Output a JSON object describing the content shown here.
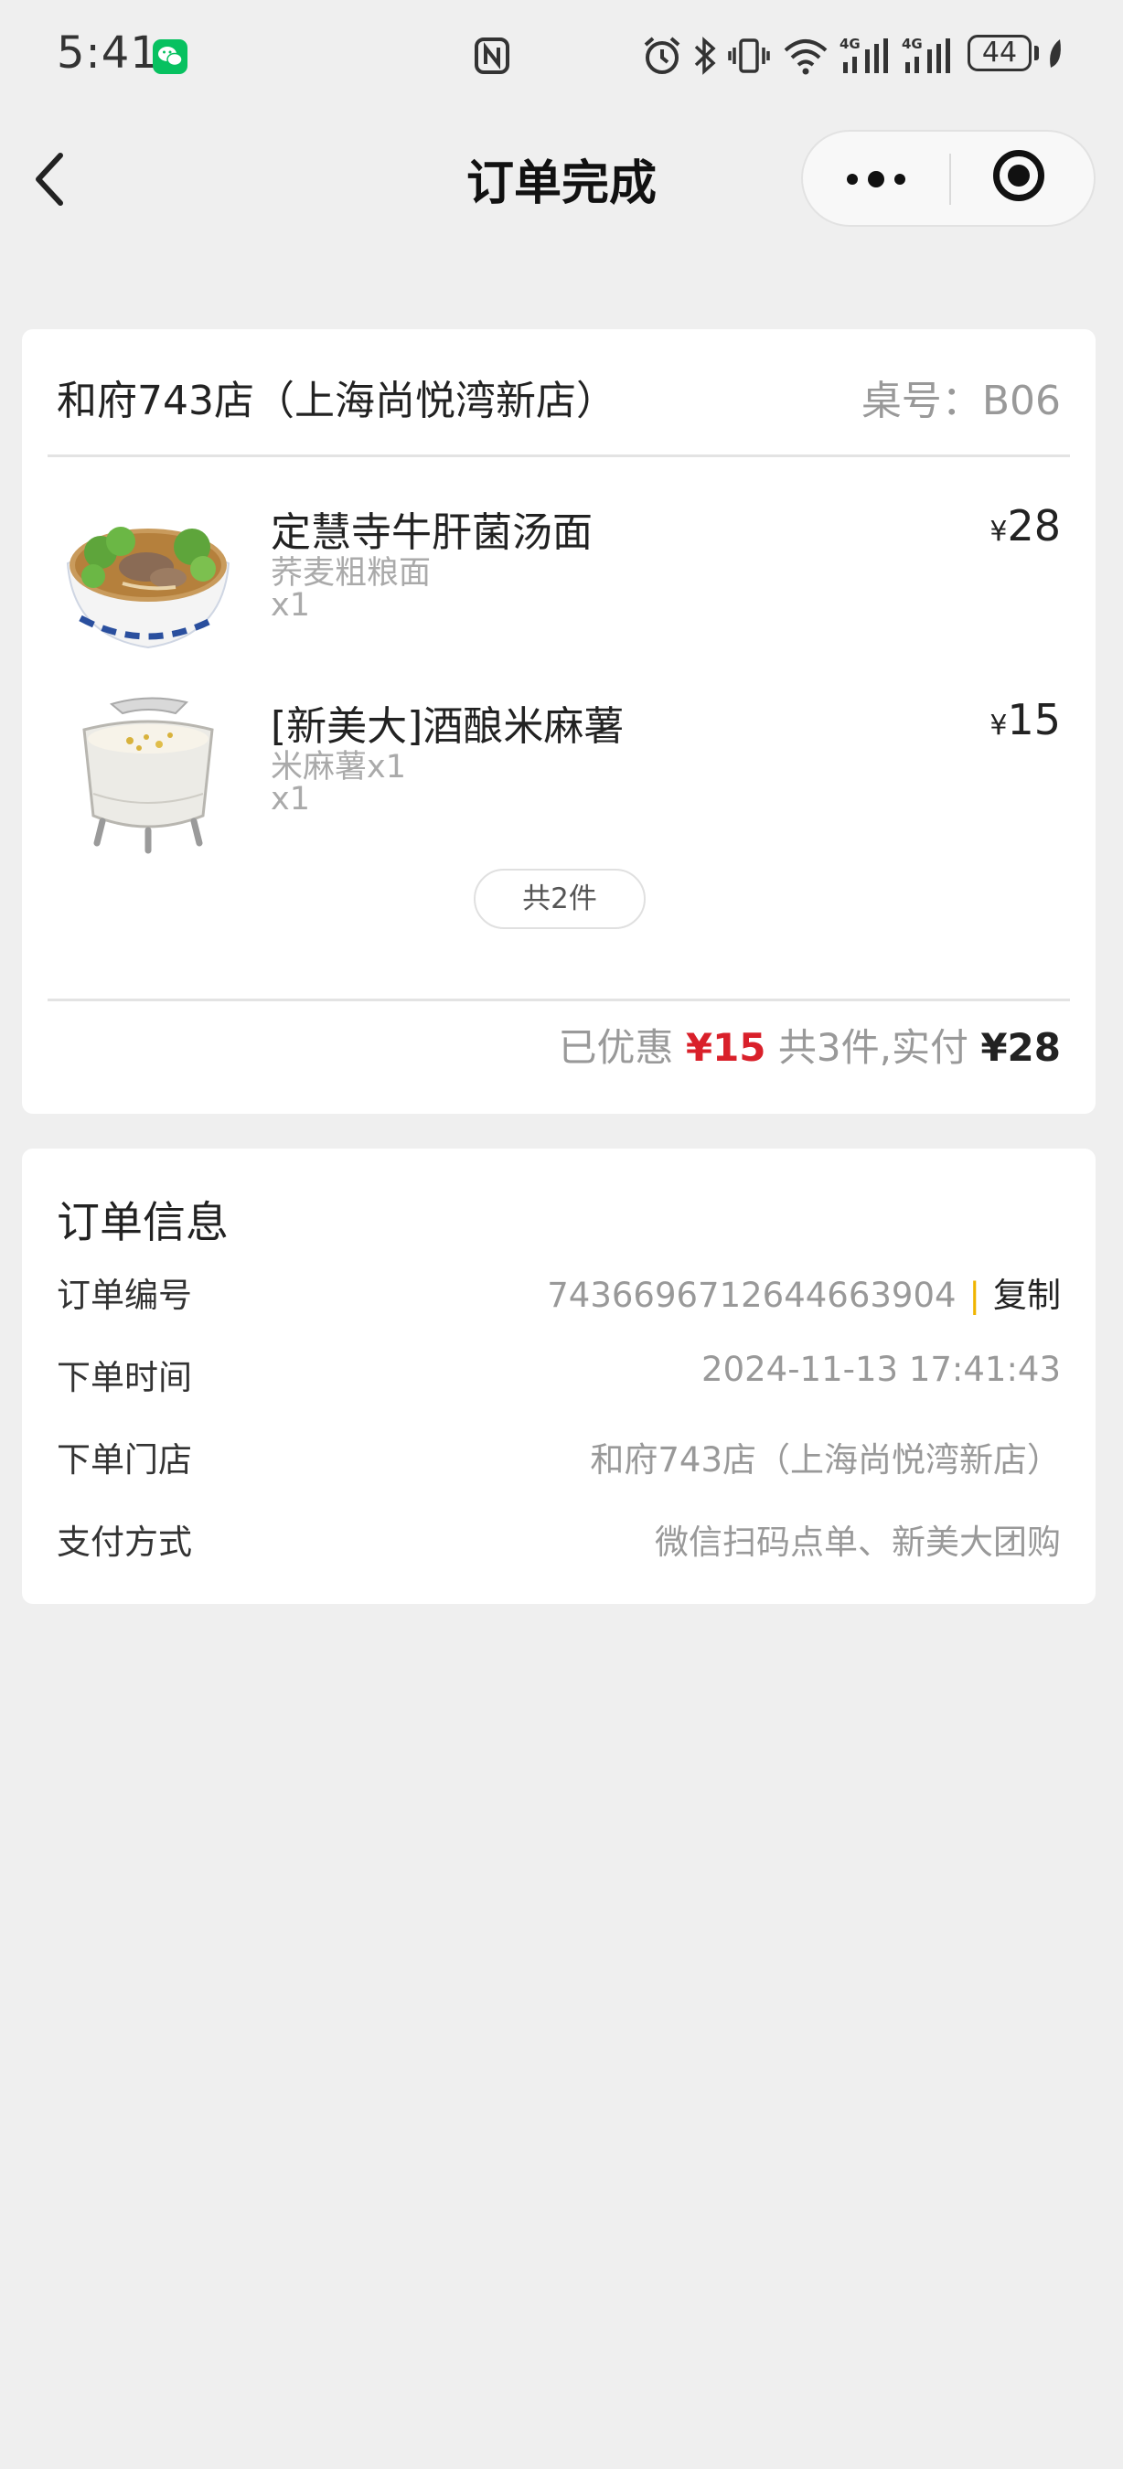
{
  "status_bar": {
    "time": "5:41",
    "battery": "44",
    "icons": [
      "wechat-icon",
      "nfc-icon",
      "alarm-icon",
      "bluetooth-icon",
      "vibrate-icon",
      "wifi-icon",
      "signal-4g-icon",
      "signal-4g-icon",
      "battery-icon",
      "leaf-icon"
    ]
  },
  "nav": {
    "title": "订单完成",
    "back_icon": "chevron-left-icon",
    "more_icon": "more-dots-icon",
    "close_icon": "target-icon"
  },
  "order": {
    "store_name": "和府743店（上海尚悦湾新店）",
    "table_label": "桌号：",
    "table_no": "B06",
    "items": [
      {
        "name": "定慧寺牛肝菌汤面",
        "spec": "荞麦粗粮面",
        "qty": "x1",
        "currency": "¥",
        "price": "28",
        "image": "noodle-soup-bowl"
      },
      {
        "name": "[新美大]酒酿米麻薯",
        "spec": "米麻薯x1",
        "qty": "x1",
        "currency": "¥",
        "price": "15",
        "image": "rice-wine-dessert-cup"
      }
    ],
    "count_pill": "共2件",
    "summary": {
      "discount_label": "已优惠",
      "discount_amount": "¥15",
      "total_label": "共3件,实付",
      "paid_amount": "¥28"
    }
  },
  "info": {
    "title": "订单信息",
    "rows": [
      {
        "label": "订单编号",
        "value": "7436696712644663904",
        "action": "复制"
      },
      {
        "label": "下单时间",
        "value": "2024-11-13 17:41:43"
      },
      {
        "label": "下单门店",
        "value": "和府743店（上海尚悦湾新店）"
      },
      {
        "label": "支付方式",
        "value": "微信扫码点单、新美大团购"
      }
    ]
  },
  "colors": {
    "background": "#efefef",
    "card": "#ffffff",
    "discount_red": "#d9202a",
    "copy_separator": "#f0b400",
    "wechat_green": "#07c160"
  }
}
